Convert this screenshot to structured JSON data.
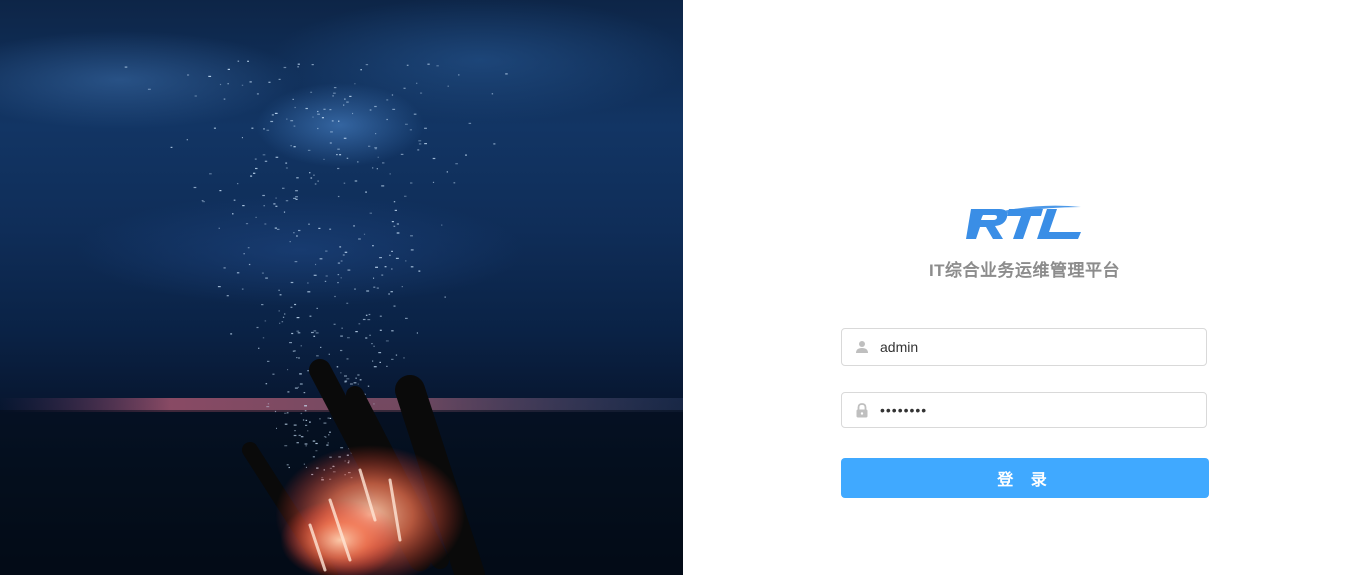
{
  "hero": {
    "image": "night-bonfire-sparks-photo"
  },
  "brand": {
    "logo_text": "RTL",
    "subtitle": "IT综合业务运维管理平台",
    "color": "#3a8ee6"
  },
  "form": {
    "username": {
      "value": "admin",
      "icon": "user-icon"
    },
    "password": {
      "value": "12345678",
      "icon": "lock-icon"
    },
    "submit_label": "登 录"
  },
  "colors": {
    "primary": "#40a9ff",
    "subtitle": "#8c8c8c",
    "border": "#d9d9d9"
  }
}
